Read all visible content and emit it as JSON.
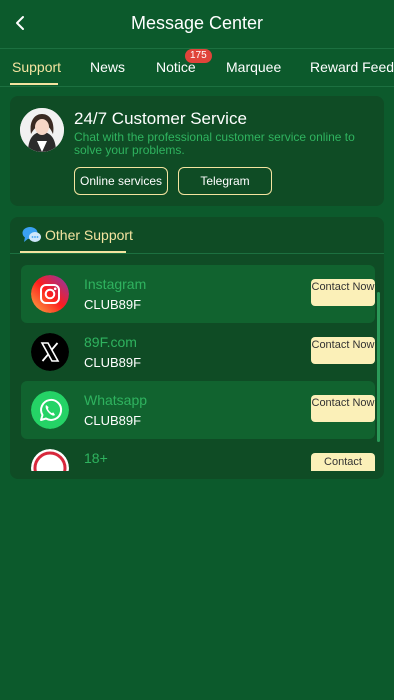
{
  "header": {
    "title": "Message Center",
    "back_icon": "chevron-left-icon"
  },
  "tabs": [
    {
      "label": "Support",
      "active": true
    },
    {
      "label": "News"
    },
    {
      "label": "Notice",
      "badge": "175"
    },
    {
      "label": "Marquee"
    },
    {
      "label": "Reward Feedb"
    }
  ],
  "customer_service": {
    "title": "24/7 Customer Service",
    "description": "Chat with the professional customer service online to solve your problems.",
    "buttons": [
      "Online services",
      "Telegram"
    ]
  },
  "other_support": {
    "label": "Other Support",
    "icon": "chat-bubbles-icon",
    "items": [
      {
        "name": "Instagram",
        "id": "CLUB89F",
        "button": "Contact Now",
        "icon": "instagram-icon"
      },
      {
        "name": "89F.com",
        "id": "CLUB89F",
        "button": "Contact Now",
        "icon": "x-icon"
      },
      {
        "name": "Whatsapp",
        "id": "CLUB89F",
        "button": "Contact Now",
        "icon": "whatsapp-icon"
      },
      {
        "name": "18+",
        "id": "",
        "button": "Contact",
        "icon": "eighteen-plus-icon"
      }
    ]
  },
  "colors": {
    "background": "#0c5a2c",
    "card": "#0f4c25",
    "accent_gold": "#f4e4a0",
    "accent_green": "#2fb35f",
    "badge_red": "#e0443a"
  }
}
